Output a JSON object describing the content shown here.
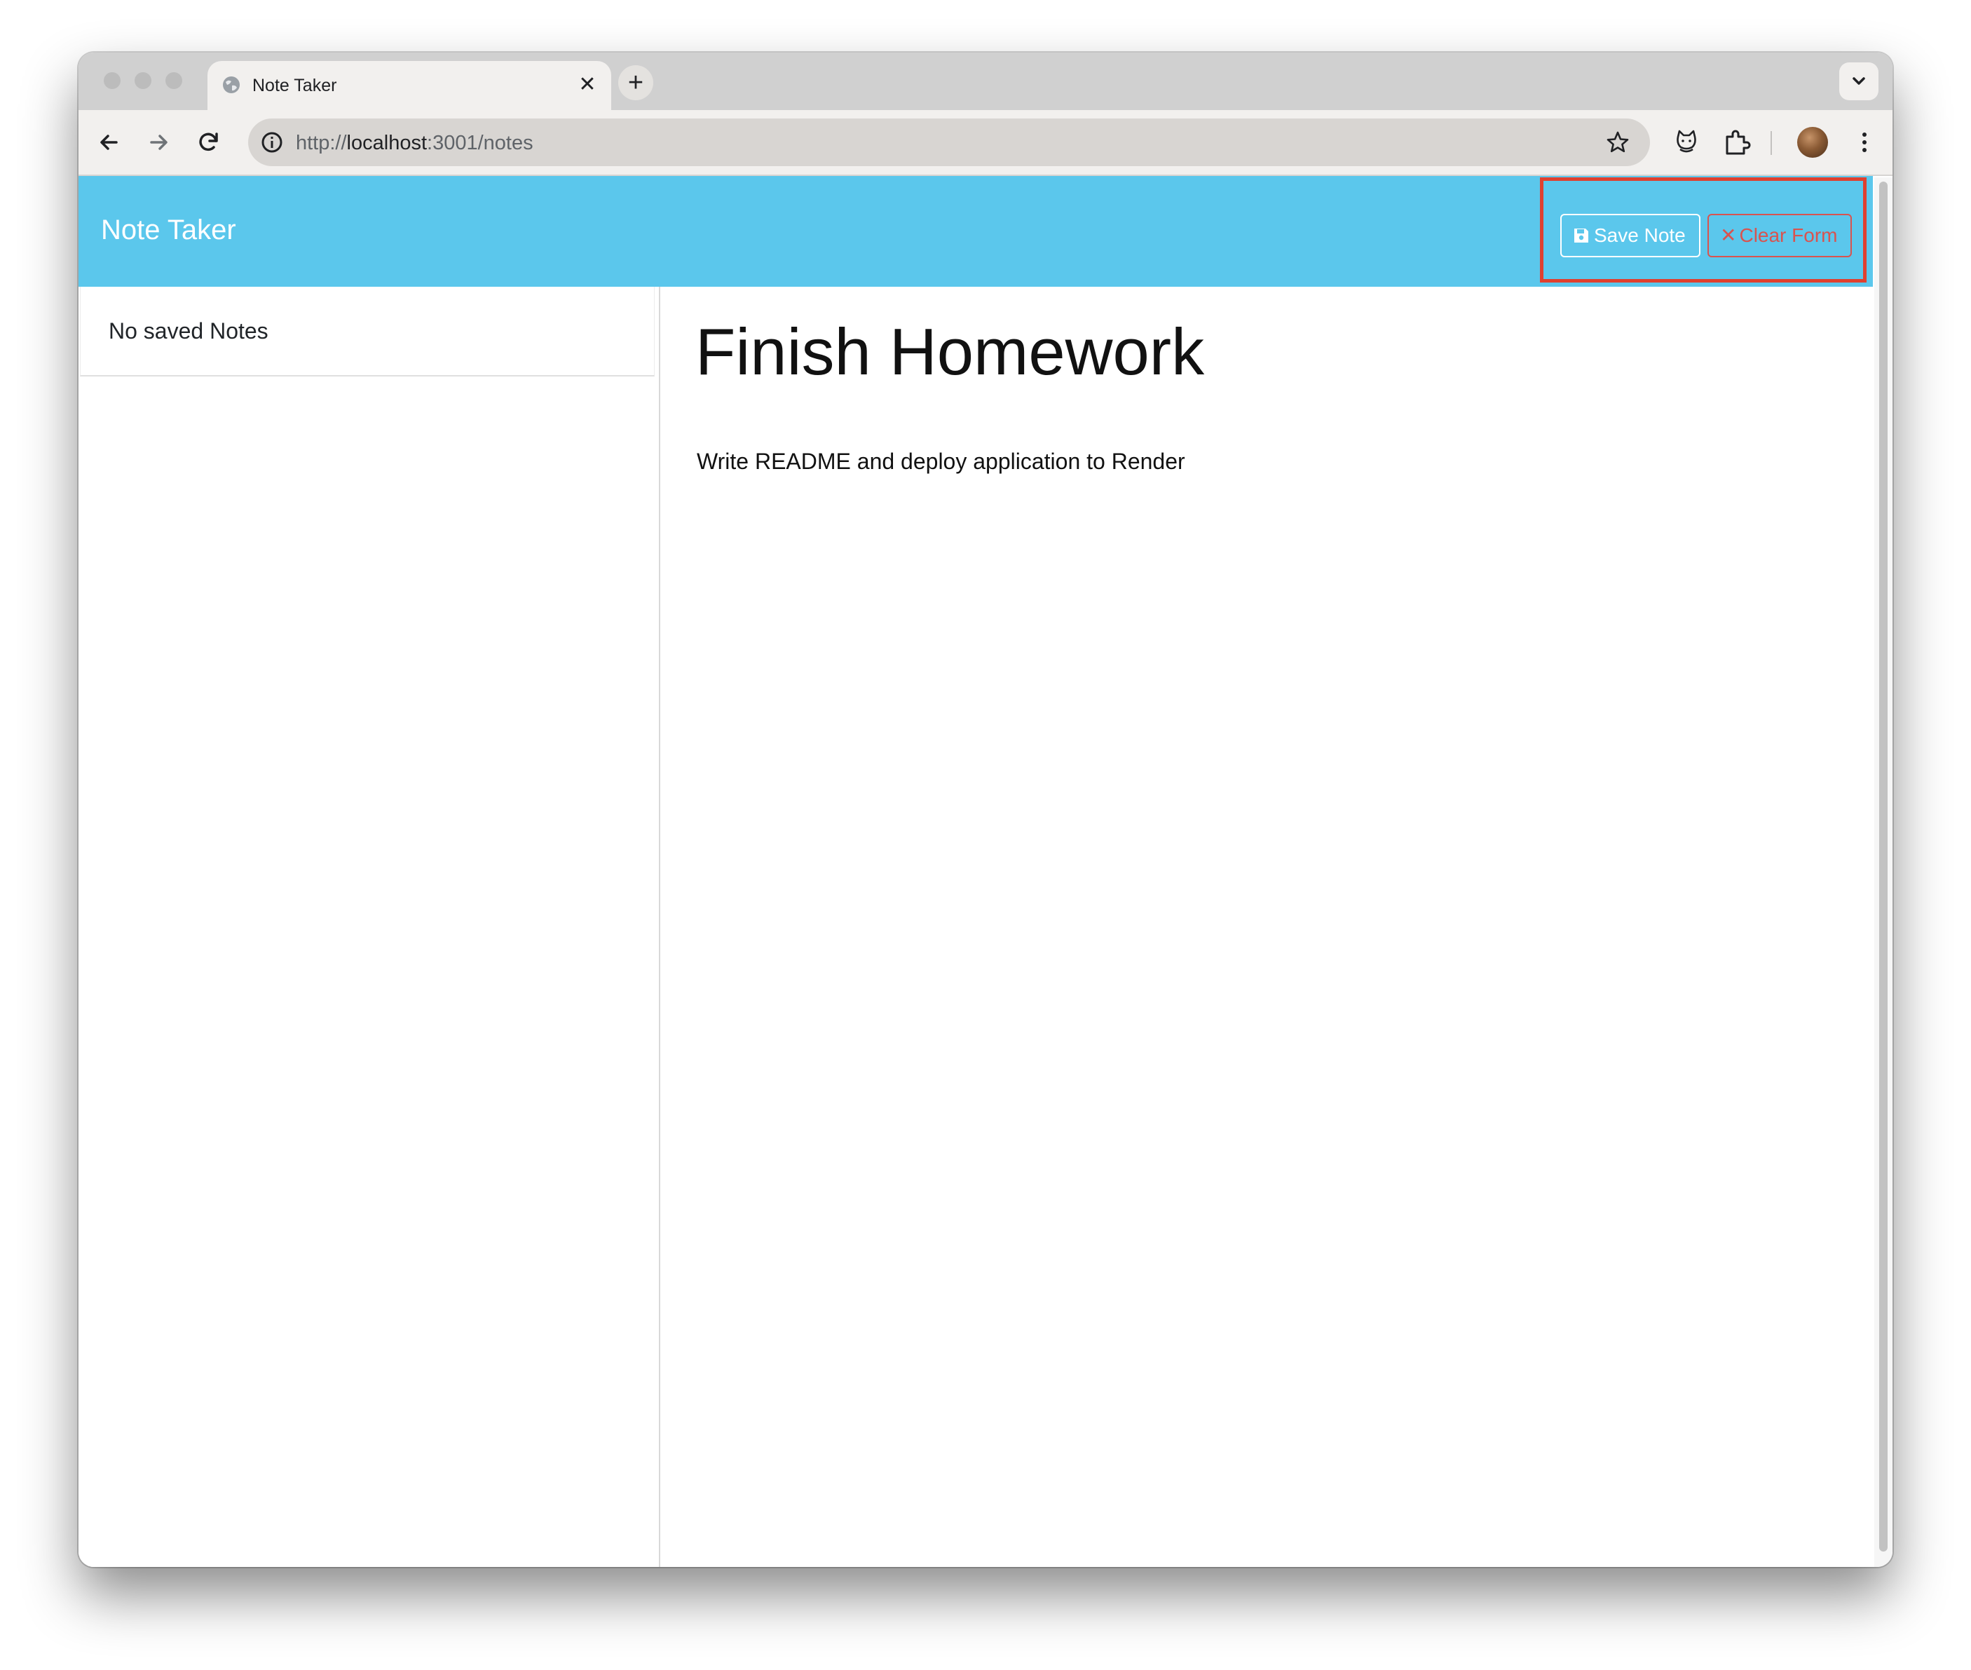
{
  "browser": {
    "tab": {
      "title": "Note Taker",
      "close_glyph": "✕"
    },
    "new_tab_glyph": "+",
    "url": {
      "scheme": "http://",
      "host": "localhost",
      "rest": ":3001/notes"
    }
  },
  "app": {
    "brand": "Note Taker",
    "toolbar": {
      "save_label": "Save Note",
      "clear_label": "Clear Form",
      "clear_icon": "✕"
    },
    "sidebar": {
      "empty_text": "No saved Notes"
    },
    "note": {
      "title": "Finish Homework",
      "text": "Write README and deploy application to Render"
    }
  },
  "colors": {
    "navbar": "#5bc7ec",
    "clear_button": "#d9534f",
    "highlight": "#e0402f"
  },
  "icons": {
    "tab": "globe-icon",
    "back": "arrow-left-icon",
    "forward": "arrow-right-icon",
    "reload": "reload-icon",
    "site_info": "info-icon",
    "bookmark": "star-icon",
    "extension_1": "cat-extension-icon",
    "extensions": "puzzle-icon",
    "menu": "kebab-menu-icon",
    "tab_search": "chevron-down-icon",
    "save": "floppy-disk-icon",
    "clear": "close-icon"
  }
}
